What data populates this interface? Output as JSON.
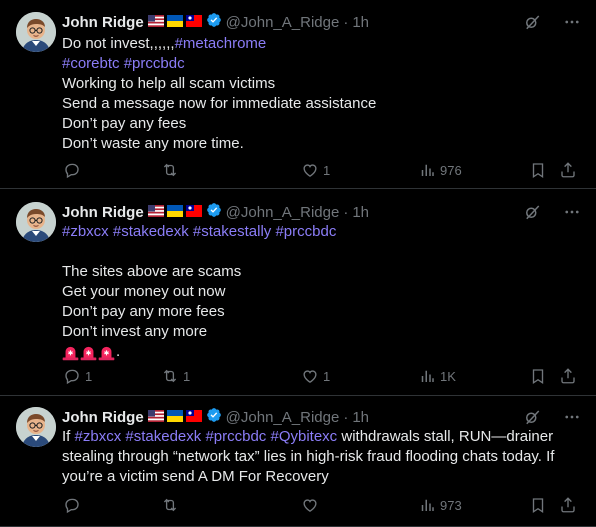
{
  "tweets": [
    {
      "author": {
        "name": "John Ridge",
        "handle": "@John_A_Ridge",
        "time": "1h",
        "flags": [
          "us-flag-icon",
          "ukraine-flag-icon",
          "taiwan-flag-icon"
        ]
      },
      "lines": [
        [
          {
            "t": "Do not invest,,,,,,",
            "k": "text"
          },
          {
            "t": "#metachrome",
            "k": "tag"
          }
        ],
        [
          {
            "t": "#corebtc",
            "k": "tag"
          },
          {
            "t": " ",
            "k": "text"
          },
          {
            "t": "#prccbdc",
            "k": "tag"
          }
        ],
        [
          {
            "t": "Working to help all scam victims",
            "k": "text"
          }
        ],
        [
          {
            "t": "Send a message now for immediate assistance",
            "k": "text"
          }
        ],
        [
          {
            "t": "Don’t pay any fees",
            "k": "text"
          }
        ],
        [
          {
            "t": "Don’t waste any more time.",
            "k": "text"
          }
        ]
      ],
      "stats": {
        "replies": "",
        "reposts": "",
        "likes": "1",
        "views": "976"
      }
    },
    {
      "author": {
        "name": "John Ridge",
        "handle": "@John_A_Ridge",
        "time": "1h",
        "flags": [
          "us-flag-icon",
          "ukraine-flag-icon",
          "taiwan-flag-icon"
        ]
      },
      "lines": [
        [
          {
            "t": "#zbxcx",
            "k": "tag"
          },
          {
            "t": " ",
            "k": "text"
          },
          {
            "t": "#stakedexk",
            "k": "tag"
          },
          {
            "t": " ",
            "k": "text"
          },
          {
            "t": "#stakestally",
            "k": "tag"
          },
          {
            "t": " ",
            "k": "text"
          },
          {
            "t": "#prccbdc",
            "k": "tag"
          }
        ],
        [],
        [
          {
            "t": "The sites above are scams",
            "k": "text"
          }
        ],
        [
          {
            "t": "Get your money out now",
            "k": "text"
          }
        ],
        [
          {
            "t": "Don’t pay any more fees",
            "k": "text"
          }
        ],
        [
          {
            "t": "Don’t invest any more",
            "k": "text"
          }
        ],
        [
          {
            "t": "siren",
            "k": "siren"
          },
          {
            "t": "siren",
            "k": "siren"
          },
          {
            "t": "siren",
            "k": "siren"
          },
          {
            "t": ".",
            "k": "text"
          }
        ]
      ],
      "stats": {
        "replies": "1",
        "reposts": "1",
        "likes": "1",
        "views": "1K"
      }
    },
    {
      "author": {
        "name": "John Ridge",
        "handle": "@John_A_Ridge",
        "time": "1h",
        "flags": [
          "us-flag-icon",
          "ukraine-flag-icon",
          "taiwan-flag-icon"
        ]
      },
      "lines": [
        [
          {
            "t": "If ",
            "k": "text"
          },
          {
            "t": "#zbxcx",
            "k": "tag"
          },
          {
            "t": " ",
            "k": "text"
          },
          {
            "t": "#stakedexk",
            "k": "tag"
          },
          {
            "t": " ",
            "k": "text"
          },
          {
            "t": "#prccbdc",
            "k": "tag"
          },
          {
            "t": " ",
            "k": "text"
          },
          {
            "t": "#Qybitexc",
            "k": "tag"
          },
          {
            "t": " withdrawals stall, RUN—drainer",
            "k": "text"
          }
        ],
        [
          {
            "t": "stealing through “network tax” lies in high-risk fraud flooding chats  today. If",
            "k": "text"
          }
        ],
        [
          {
            "t": "you’re a victim send A DM For Recovery",
            "k": "text"
          }
        ]
      ],
      "stats": {
        "replies": "",
        "reposts": "",
        "likes": "",
        "views": "973"
      }
    }
  ],
  "colors": {
    "background": "#000000",
    "text": "#e7e9ea",
    "muted": "#71767b",
    "hashtag": "#1d9bf0",
    "verified": "#1d9bf0",
    "border": "#2f3336"
  }
}
